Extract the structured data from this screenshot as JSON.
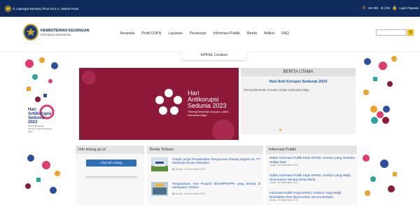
{
  "topbar": {
    "address": "Jl. Lapangan Banteng Timur No.2-4, Jakarta Pusat",
    "phone": "134 991",
    "lang": "ID | EN",
    "login": "Login Pegawai"
  },
  "brand": {
    "name": "KEMENTERIAN KEUANGAN",
    "sub": "REPUBLIK INDONESIA"
  },
  "nav": [
    "Beranda",
    "Profil DJKN",
    "Layanan",
    "Peraturan",
    "Informasi Publik",
    "Berita",
    "Artikel",
    "FAQ"
  ],
  "search": {
    "placeholder": ""
  },
  "page_title": "KPKNL Cirebon",
  "hero": {
    "title_line1": "Hari",
    "title_line2": "Antikorupsi",
    "title_line3": "Sedunia 2023",
    "tagline": "\"Sinergi Berantas Korupsi, Untuk Indonesia Maju\""
  },
  "side_banner": {
    "title_line1": "Hari",
    "title_line2": "Antikorupsi",
    "title_line3": "Sedunia 2023",
    "sub": "Sinergi Berantas Korupsi, Untuk Indonesia Maju"
  },
  "berita_utama": {
    "label": "BERITA UTAMA",
    "headline": "Hari Anti Korupsi Sedunai 2023",
    "desc": "Sinergi Berantas Korupsi, Untuk Indonesia Maju"
  },
  "col_lelang": {
    "title": "Info lelang.go.id",
    "button": "Lihat Info Lelang"
  },
  "col_berita": {
    "title": "Berita Terbaru",
    "items": [
      {
        "title": "Tindak Lanjut Penyelesaian Pengurusan Piutang Negara an. PT Hacienda Ocean Industries",
        "date": "Selasa, 19 Desember 2023"
      },
      {
        "title": "Pengamanan Aset Properti Eks-BPPN/PPA yang berada di Kabupaten Cirebon",
        "date": "Jumat, 15 Desember 2023"
      }
    ]
  },
  "col_info": {
    "title": "Informasi Publik",
    "items": [
      {
        "title": "Daftar Informasi Publik Pada KPKNL Cirebon yang Tersedia Setiap Saat",
        "date": "Jumat, 15 September 2023"
      },
      {
        "title": "Daftar Informasi Publik Pada KPKNL Cirebon yang Wajib Diumumkan Secara Serta Merta",
        "date": "Jumat, 15 September 2023"
      },
      {
        "title": "Informasi Publik Pada KPKNL Cirebon Yang Wajib Disediakan Dan Diumumkan Secara Berkala",
        "date": "Jumat, 15 September 2023"
      }
    ]
  },
  "colors": {
    "topbar": "#0f2b5b",
    "accent": "#f4c20d",
    "hero": "#8e1838",
    "link": "#1a56b5"
  }
}
